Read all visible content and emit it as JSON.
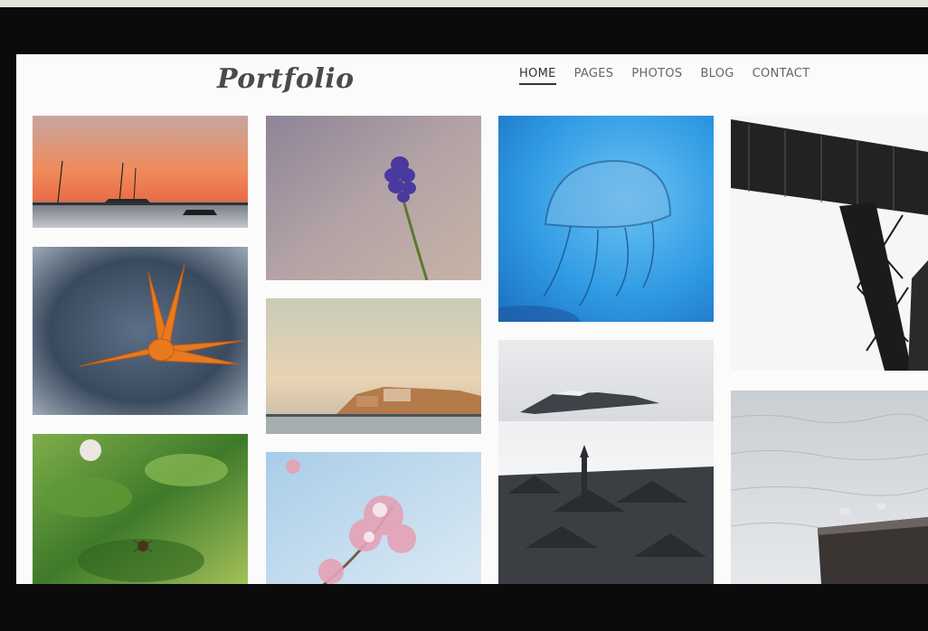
{
  "site": {
    "logo_text": "Portfolio"
  },
  "nav": {
    "items": [
      {
        "label": "HOME",
        "active": true
      },
      {
        "label": "PAGES",
        "active": false
      },
      {
        "label": "PHOTOS",
        "active": false
      },
      {
        "label": "BLOG",
        "active": false
      },
      {
        "label": "CONTACT",
        "active": false
      }
    ]
  },
  "gallery": {
    "photos": [
      {
        "id": "sunset-sailboats"
      },
      {
        "id": "grape-hyacinth"
      },
      {
        "id": "jellyfish"
      },
      {
        "id": "steel-bridge"
      },
      {
        "id": "starfish"
      },
      {
        "id": "coastal-town"
      },
      {
        "id": "misty-village"
      },
      {
        "id": "sea-gulls"
      },
      {
        "id": "spider-leaves"
      },
      {
        "id": "pink-blossom"
      }
    ]
  },
  "colors": {
    "screen_bg": "#fbfbfb",
    "frame": "#0b0b0c",
    "nav_text": "#666666",
    "nav_active": "#333333"
  }
}
